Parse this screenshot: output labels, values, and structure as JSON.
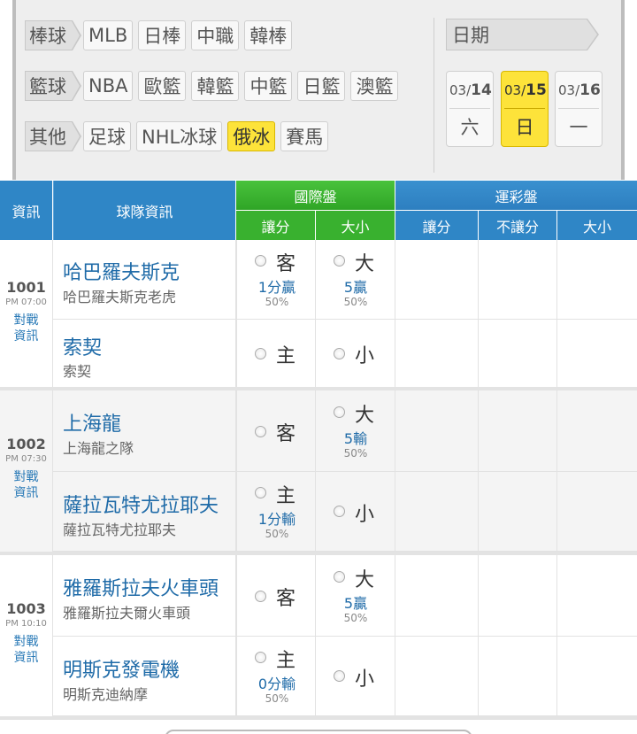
{
  "filters": {
    "rows": [
      {
        "category": "棒球",
        "items": [
          "MLB",
          "日棒",
          "中職",
          "韓棒"
        ]
      },
      {
        "category": "籃球",
        "items": [
          "NBA",
          "歐籃",
          "韓籃",
          "中籃",
          "日籃",
          "澳籃"
        ]
      },
      {
        "category": "其他",
        "items": [
          "足球",
          "NHL冰球",
          "俄冰",
          "賽馬"
        ]
      }
    ],
    "active_item": "俄冰",
    "date_label": "日期",
    "dates": [
      {
        "month": "03/",
        "day": "14",
        "weekday": "六"
      },
      {
        "month": "03/",
        "day": "15",
        "weekday": "日"
      },
      {
        "month": "03/",
        "day": "16",
        "weekday": "一"
      }
    ],
    "active_date": "15"
  },
  "table_header": {
    "info": "資訊",
    "team_info": "球隊資訊",
    "intl": "國際盤",
    "intl_spread": "讓分",
    "intl_total": "大小",
    "lottery": "運彩盤",
    "lot_spread": "讓分",
    "lot_nospread": "不讓分",
    "lot_total": "大小"
  },
  "games": [
    {
      "number": "1001",
      "time": "PM 07:00",
      "link1": "對戰",
      "link2": "資訊",
      "away": {
        "name": "哈巴羅夫斯克",
        "full": "哈巴羅夫斯克老虎",
        "spread_side": "客",
        "spread_line": "1分贏",
        "spread_pct": "50%",
        "total_side": "大",
        "total_line": "5贏",
        "total_pct": "50%"
      },
      "home": {
        "name": "索契",
        "full": "索契",
        "spread_side": "主",
        "spread_line": "",
        "spread_pct": "",
        "total_side": "小",
        "total_line": "",
        "total_pct": ""
      }
    },
    {
      "number": "1002",
      "time": "PM 07:30",
      "link1": "對戰",
      "link2": "資訊",
      "away": {
        "name": "上海龍",
        "full": "上海龍之隊",
        "spread_side": "客",
        "spread_line": "",
        "spread_pct": "",
        "total_side": "大",
        "total_line": "5輸",
        "total_pct": "50%"
      },
      "home": {
        "name": "薩拉瓦特尤拉耶夫",
        "full": "薩拉瓦特尤拉耶夫",
        "spread_side": "主",
        "spread_line": "1分輸",
        "spread_pct": "50%",
        "total_side": "小",
        "total_line": "",
        "total_pct": ""
      }
    },
    {
      "number": "1003",
      "time": "PM 10:10",
      "link1": "對戰",
      "link2": "資訊",
      "away": {
        "name": "雅羅斯拉夫火車頭",
        "full": "雅羅斯拉夫爾火車頭",
        "spread_side": "客",
        "spread_line": "",
        "spread_pct": "",
        "total_side": "大",
        "total_line": "5贏",
        "total_pct": "50%"
      },
      "home": {
        "name": "明斯克發電機",
        "full": "明斯克迪納摩",
        "spread_side": "主",
        "spread_line": "0分輸",
        "spread_pct": "50%",
        "total_side": "小",
        "total_line": "",
        "total_pct": ""
      }
    }
  ]
}
